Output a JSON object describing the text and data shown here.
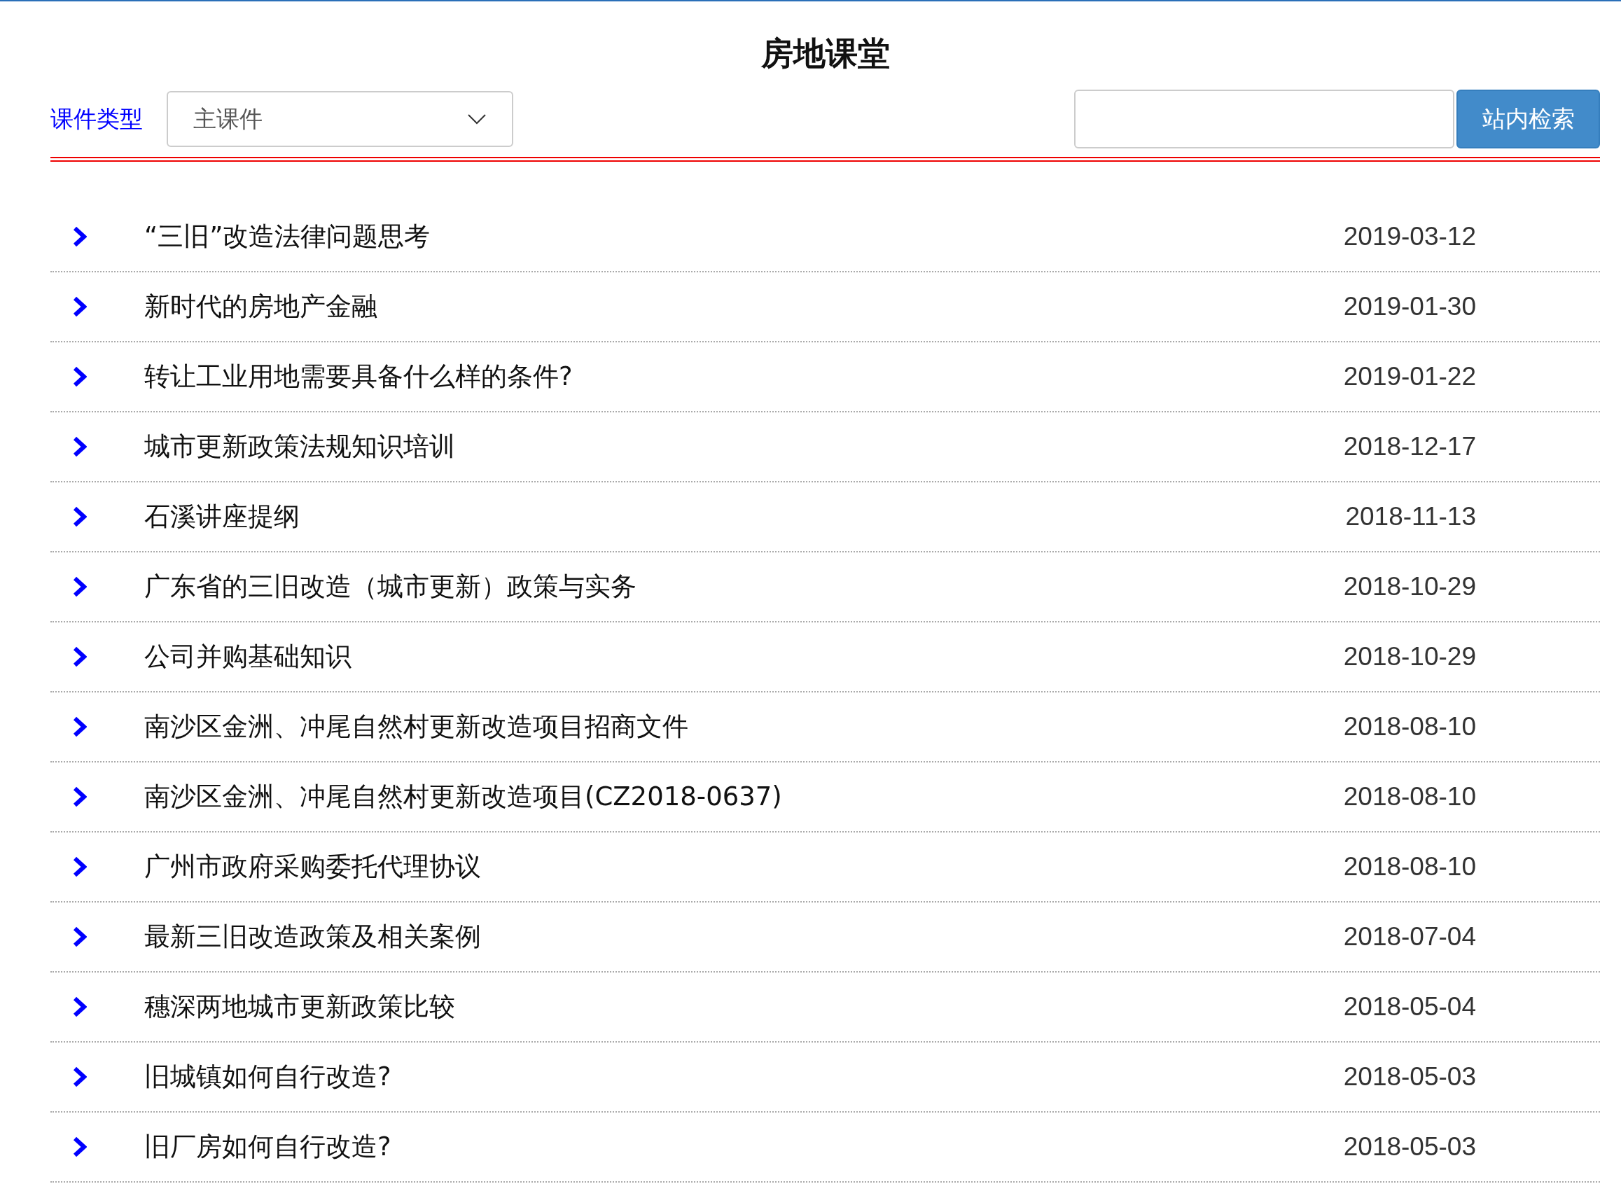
{
  "title": "房地课堂",
  "filter": {
    "label": "课件类型",
    "select_value": "主课件"
  },
  "search": {
    "button": "站内检索"
  },
  "items": [
    {
      "title": "“三旧”改造法律问题思考",
      "date": "2019-03-12"
    },
    {
      "title": "新时代的房地产金融",
      "date": "2019-01-30"
    },
    {
      "title": "转让工业用地需要具备什么样的条件?",
      "date": "2019-01-22"
    },
    {
      "title": "城市更新政策法规知识培训",
      "date": "2018-12-17"
    },
    {
      "title": "石溪讲座提纲",
      "date": "2018-11-13"
    },
    {
      "title": "广东省的三旧改造（城市更新）政策与实务",
      "date": "2018-10-29"
    },
    {
      "title": "公司并购基础知识",
      "date": "2018-10-29"
    },
    {
      "title": "南沙区金洲、冲尾自然村更新改造项目招商文件",
      "date": "2018-08-10"
    },
    {
      "title": "南沙区金洲、冲尾自然村更新改造项目(CZ2018-0637)",
      "date": "2018-08-10"
    },
    {
      "title": "广州市政府采购委托代理协议",
      "date": "2018-08-10"
    },
    {
      "title": "最新三旧改造政策及相关案例",
      "date": "2018-07-04"
    },
    {
      "title": "穗深两地城市更新政策比较",
      "date": "2018-05-04"
    },
    {
      "title": "旧城镇如何自行改造?",
      "date": "2018-05-03"
    },
    {
      "title": "旧厂房如何自行改造?",
      "date": "2018-05-03"
    }
  ]
}
